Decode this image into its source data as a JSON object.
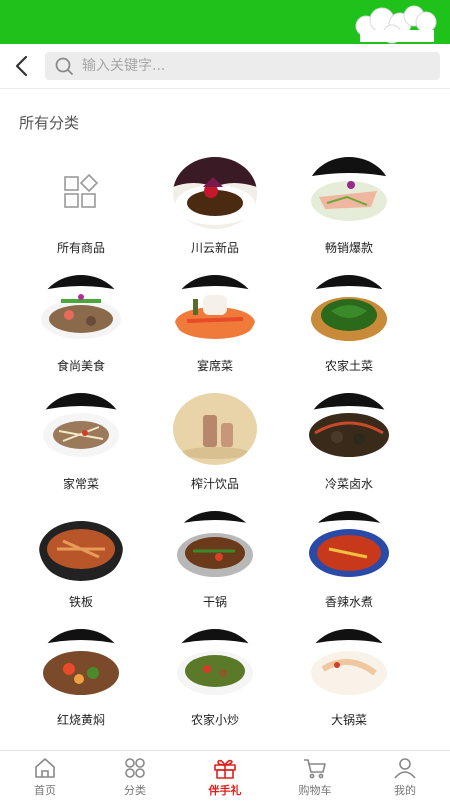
{
  "search": {
    "placeholder": "输入关键字..."
  },
  "section": {
    "title": "所有分类"
  },
  "categories": [
    {
      "label": "所有商品",
      "icon": "grid-icon"
    },
    {
      "label": "川云新品"
    },
    {
      "label": "畅销爆款"
    },
    {
      "label": "食尚美食"
    },
    {
      "label": "宴席菜"
    },
    {
      "label": "农家土菜"
    },
    {
      "label": "家常菜"
    },
    {
      "label": "榨汁饮品"
    },
    {
      "label": "冷菜卤水"
    },
    {
      "label": "铁板"
    },
    {
      "label": "干锅"
    },
    {
      "label": "香辣水煮"
    },
    {
      "label": "红烧黄焖"
    },
    {
      "label": "农家小炒"
    },
    {
      "label": "大锅菜"
    }
  ],
  "tabbar": {
    "items": [
      {
        "label": "首页",
        "icon": "home-icon"
      },
      {
        "label": "分类",
        "icon": "category-icon"
      },
      {
        "label": "伴手礼",
        "icon": "gift-icon",
        "active": true
      },
      {
        "label": "购物车",
        "icon": "cart-icon"
      },
      {
        "label": "我的",
        "icon": "user-icon"
      }
    ]
  },
  "colors": {
    "header_green": "#1fc21a",
    "active_red": "#e0201a"
  }
}
